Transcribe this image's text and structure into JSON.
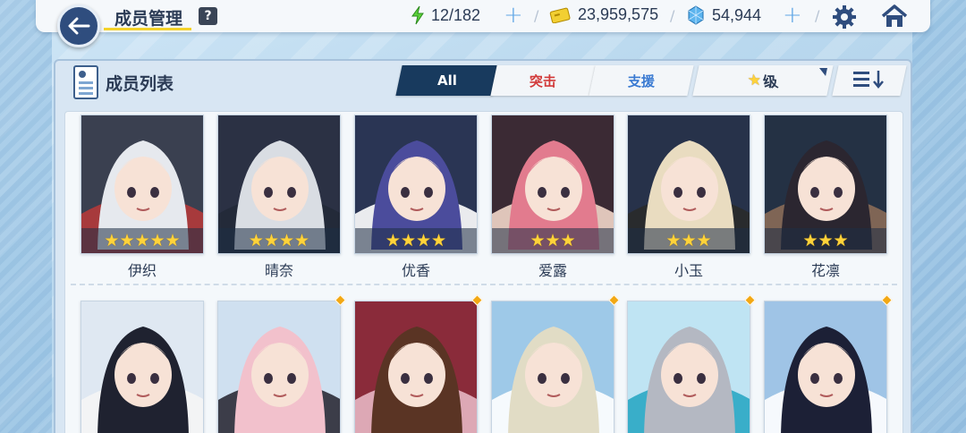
{
  "header": {
    "title": "成员管理",
    "help_label": "?",
    "ap": "12/182",
    "credits": "23,959,575",
    "pyroxene": "54,944",
    "plus_label": "+",
    "separator": "/"
  },
  "panel": {
    "title": "成员列表",
    "tabs": [
      {
        "label": "All"
      },
      {
        "label": "突击"
      },
      {
        "label": "支援"
      }
    ],
    "sort_label": "级",
    "sort_star": "★"
  },
  "members_row1": [
    {
      "name": "伊织",
      "stars": "★★★★★",
      "bg": "#3a4050",
      "hair": "#e6e9ee",
      "accent": "#b43a3a"
    },
    {
      "name": "晴奈",
      "stars": "★★★★",
      "bg": "#2b3144",
      "hair": "#d9dde3",
      "accent": "#222a38"
    },
    {
      "name": "优香",
      "stars": "★★★★",
      "bg": "#2a3554",
      "hair": "#4b4c9c",
      "accent": "#ffffff"
    },
    {
      "name": "爱露",
      "stars": "★★★",
      "bg": "#3b2a34",
      "hair": "#e27b8e",
      "accent": "#f2d6c9"
    },
    {
      "name": "小玉",
      "stars": "★★★",
      "bg": "#27324a",
      "hair": "#e9dcc0",
      "accent": "#2a2a2a"
    },
    {
      "name": "花凛",
      "stars": "★★★",
      "bg": "#243144",
      "hair": "#2b2630",
      "accent": "#8a6b58"
    }
  ],
  "members_row2": [
    {
      "bg": "#dfe8f2",
      "hair": "#1f2230",
      "accent": "#f5f5f5"
    },
    {
      "bg": "#cfe0f0",
      "hair": "#f2c1cc",
      "accent": "#2b2b36"
    },
    {
      "bg": "#8a2b3a",
      "hair": "#5a3424",
      "accent": "#e5b6c3"
    },
    {
      "bg": "#9ec9e8",
      "hair": "#e1dcc5",
      "accent": "#ffffff"
    },
    {
      "bg": "#bfe4f3",
      "hair": "#b4b8c2",
      "accent": "#2aa7c4"
    },
    {
      "bg": "#9fc4e6",
      "hair": "#1c2036",
      "accent": "#ffffff"
    }
  ],
  "colors": {
    "accent_gold": "#f4d22a",
    "tab_active": "#183a5e",
    "strike": "#d23a3a",
    "support": "#3a7ad2",
    "star": "#ffd33a"
  }
}
